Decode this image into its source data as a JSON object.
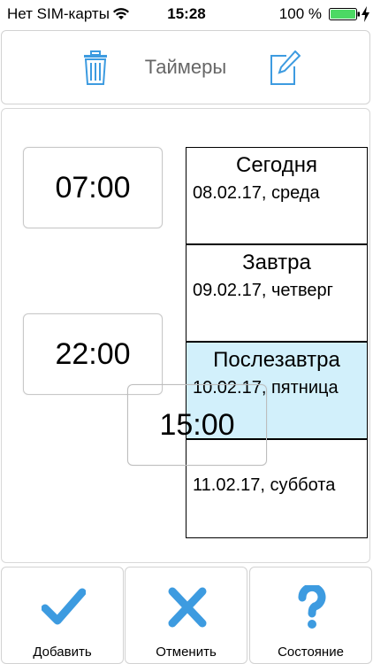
{
  "status_bar": {
    "carrier": "Нет SIM-карты",
    "time": "15:28",
    "battery": "100 %"
  },
  "header": {
    "title": "Таймеры",
    "icons": [
      "trash-icon",
      "edit-icon"
    ]
  },
  "timers": [
    {
      "time": "07:00"
    },
    {
      "time": "22:00"
    },
    {
      "time": "15:00"
    }
  ],
  "days": [
    {
      "name": "Сегодня",
      "date": "08.02.17, среда",
      "selected": false
    },
    {
      "name": "Завтра",
      "date": "09.02.17, четверг",
      "selected": false
    },
    {
      "name": "Послезавтра",
      "date": "10.02.17, пятница",
      "selected": true
    },
    {
      "name": "",
      "date": "11.02.17, суббота",
      "selected": false
    }
  ],
  "toolbar": {
    "add_label": "Добавить",
    "cancel_label": "Отменить",
    "status_label": "Состояние"
  },
  "colors": {
    "accent_blue": "#3d9be0",
    "selected_cell": "#d2f0fb",
    "title_gray": "#666666"
  }
}
